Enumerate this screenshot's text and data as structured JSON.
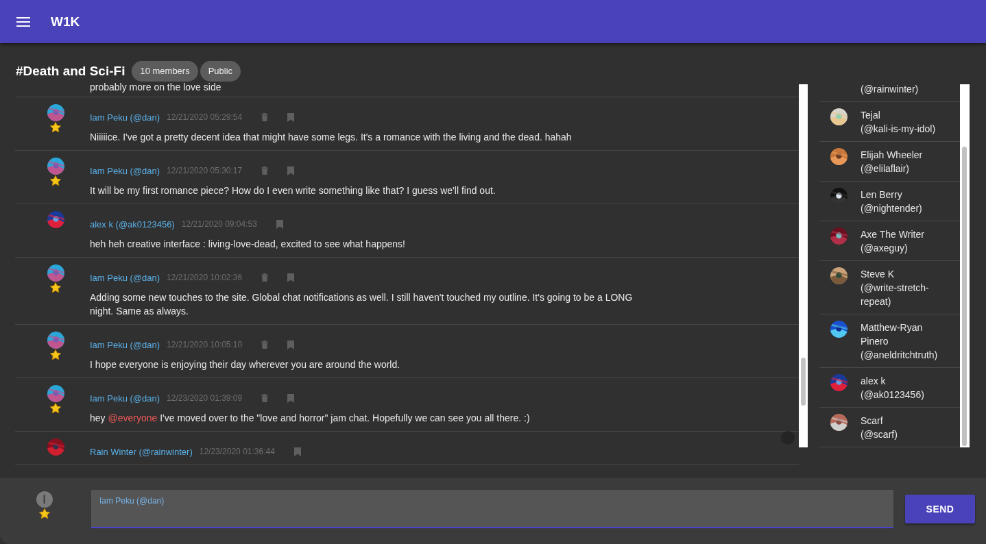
{
  "app_bar": {
    "title": "W1K"
  },
  "channel": {
    "title": "#Death and Sci-Fi",
    "chips": [
      "10 members",
      "Public"
    ]
  },
  "messages": [
    {
      "kind": "partial",
      "body": "probably more on the love side"
    },
    {
      "kind": "own",
      "author": "Iam Peku (@dan)",
      "time": "12/21/2020 05:29:54",
      "starred": true,
      "body": "Niiiiice. I've got a pretty decent idea that might have some legs. It's a romance with the living and the dead. hahah"
    },
    {
      "kind": "own",
      "author": "Iam Peku (@dan)",
      "time": "12/21/2020 05:30:17",
      "starred": true,
      "body": "It will be my first romance piece? How do I even write something like that? I guess we'll find out."
    },
    {
      "kind": "other",
      "author": "alex k (@ak0123456)",
      "time": "12/21/2020 09:04:53",
      "starred": false,
      "body": "heh heh creative interface : living-love-dead, excited to see what happens!"
    },
    {
      "kind": "own",
      "author": "Iam Peku (@dan)",
      "time": "12/21/2020 10:02:36",
      "starred": true,
      "body": "Adding some new touches to the site. Global chat notifications as well. I still haven't touched my outline. It's going to be a LONG night. Same as always."
    },
    {
      "kind": "own",
      "author": "Iam Peku (@dan)",
      "time": "12/21/2020 10:05:10",
      "starred": true,
      "body": "I hope everyone is enjoying their day wherever you are around the world."
    },
    {
      "kind": "own",
      "author": "Iam Peku (@dan)",
      "time": "12/23/2020 01:39:09",
      "starred": true,
      "body": "hey ",
      "mention": "@everyone",
      "body_after": " I've moved over to the \"love and horror\" jam chat. Hopefully we can see you all there. :)"
    },
    {
      "kind": "other",
      "author": "Rain Winter (@rainwinter)",
      "time": "12/23/2020 01:36:44",
      "starred": false
    }
  ],
  "members": [
    {
      "handle": "(@rainwinter)"
    },
    {
      "name": "Tejal",
      "handle": "(@kali-is-my-idol)"
    },
    {
      "name": "Elijah Wheeler",
      "handle": "(@elilaflair)"
    },
    {
      "name": "Len Berry",
      "handle": "(@nightender)"
    },
    {
      "name": "Axe The Writer",
      "handle": "(@axeguy)"
    },
    {
      "name": "Steve K",
      "handle": "(@write-stretch-repeat)"
    },
    {
      "name": "Matthew-Ryan Pinero",
      "handle": "(@aneldritchtruth)"
    },
    {
      "name": "alex k",
      "handle": "(@ak0123456)"
    },
    {
      "name": "Scarf",
      "handle": "(@scarf)"
    }
  ],
  "composer": {
    "avatar_letter": "I",
    "starred": true,
    "label": "Iam Peku (@dan)",
    "send": "SEND"
  }
}
